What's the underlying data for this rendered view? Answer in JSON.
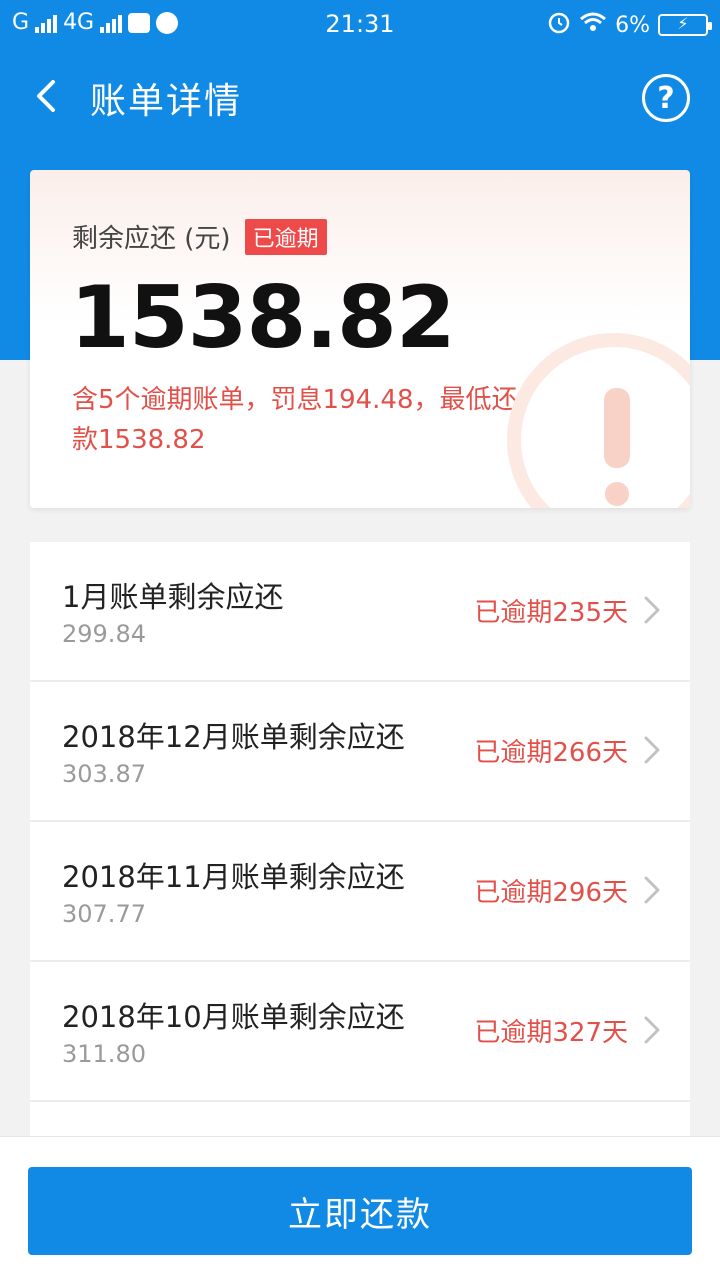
{
  "colors": {
    "brand_blue": "#118ae6",
    "overdue_red": "#e2504a",
    "badge_red": "#ee4a4a"
  },
  "status_bar": {
    "carrier_1": "G",
    "carrier_2": "4G",
    "time": "21:31",
    "battery": "6%",
    "icons": [
      "signal-icon",
      "mail-icon",
      "app-icon",
      "alarm-icon",
      "wifi-icon",
      "battery-charging-icon"
    ]
  },
  "nav": {
    "title": "账单详情",
    "back_icon": "chevron-left-icon",
    "help_icon": "help-circle-icon",
    "help_glyph": "?"
  },
  "summary": {
    "label": "剩余应还 (元)",
    "badge": "已逾期",
    "amount": "1538.82",
    "note": "含5个逾期账单，罚息194.48，最低还款1538.82"
  },
  "bills": [
    {
      "title": "1月账单剩余应还",
      "amount": "299.84",
      "status": "已逾期235天"
    },
    {
      "title": "2018年12月账单剩余应还",
      "amount": "303.87",
      "status": "已逾期266天"
    },
    {
      "title": "2018年11月账单剩余应还",
      "amount": "307.77",
      "status": "已逾期296天"
    },
    {
      "title": "2018年10月账单剩余应还",
      "amount": "311.80",
      "status": "已逾期327天"
    }
  ],
  "pay_button": "立即还款"
}
